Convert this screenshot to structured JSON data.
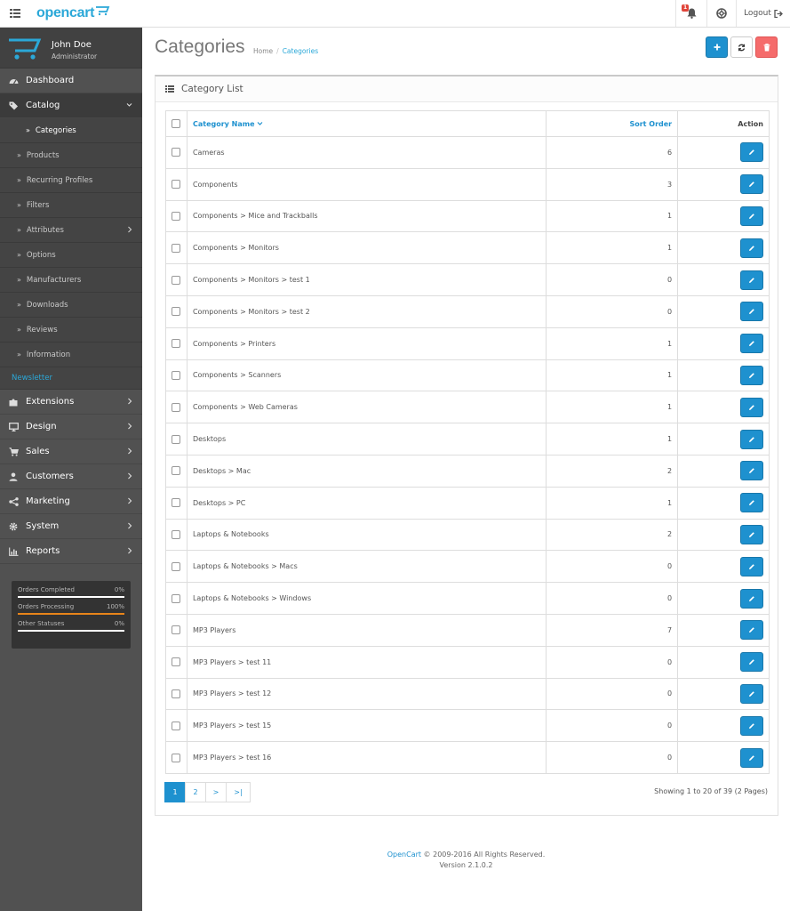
{
  "header": {
    "logo_text": "opencart",
    "notification_count": "1",
    "logout_label": "Logout"
  },
  "profile": {
    "name": "John Doe",
    "role": "Administrator"
  },
  "nav": {
    "dashboard": "Dashboard",
    "catalog": "Catalog",
    "catalog_sub": {
      "categories": "Categories",
      "products": "Products",
      "recurring": "Recurring Profiles",
      "filters": "Filters",
      "attributes": "Attributes",
      "options": "Options",
      "manufacturers": "Manufacturers",
      "downloads": "Downloads",
      "reviews": "Reviews",
      "information": "Information"
    },
    "newsletter": "Newsletter",
    "extensions": "Extensions",
    "design": "Design",
    "sales": "Sales",
    "customers": "Customers",
    "marketing": "Marketing",
    "system": "System",
    "reports": "Reports"
  },
  "stats": [
    {
      "label": "Orders Completed",
      "value": "0%",
      "fraction": 0
    },
    {
      "label": "Orders Processing",
      "value": "100%",
      "fraction": 1
    },
    {
      "label": "Other Statuses",
      "value": "0%",
      "fraction": 0
    }
  ],
  "page": {
    "title": "Categories",
    "breadcrumb_home": "Home",
    "breadcrumb_sep": "/",
    "breadcrumb_current": "Categories"
  },
  "panel": {
    "title": "Category List"
  },
  "table": {
    "col_name": "Category Name",
    "col_sort": "Sort Order",
    "col_action": "Action",
    "rows": [
      {
        "name": "Cameras",
        "sort": "6"
      },
      {
        "name": "Components",
        "sort": "3"
      },
      {
        "name": "Components  >  Mice and Trackballs",
        "sort": "1"
      },
      {
        "name": "Components  >  Monitors",
        "sort": "1"
      },
      {
        "name": "Components  >  Monitors  >  test 1",
        "sort": "0"
      },
      {
        "name": "Components  >  Monitors  >  test 2",
        "sort": "0"
      },
      {
        "name": "Components  >  Printers",
        "sort": "1"
      },
      {
        "name": "Components  >  Scanners",
        "sort": "1"
      },
      {
        "name": "Components  >  Web Cameras",
        "sort": "1"
      },
      {
        "name": "Desktops",
        "sort": "1"
      },
      {
        "name": "Desktops  >  Mac",
        "sort": "2"
      },
      {
        "name": "Desktops  >  PC",
        "sort": "1"
      },
      {
        "name": "Laptops & Notebooks",
        "sort": "2"
      },
      {
        "name": "Laptops & Notebooks  >  Macs",
        "sort": "0"
      },
      {
        "name": "Laptops & Notebooks  >  Windows",
        "sort": "0"
      },
      {
        "name": "MP3 Players",
        "sort": "7"
      },
      {
        "name": "MP3 Players  >  test 11",
        "sort": "0"
      },
      {
        "name": "MP3 Players  >  test 12",
        "sort": "0"
      },
      {
        "name": "MP3 Players  >  test 15",
        "sort": "0"
      },
      {
        "name": "MP3 Players  >  test 16",
        "sort": "0"
      }
    ]
  },
  "pagination": {
    "pages": [
      "1",
      "2",
      ">",
      ">|"
    ],
    "active": "1",
    "showing": "Showing 1 to 20 of 39 (2 Pages)"
  },
  "footer": {
    "link": "OpenCart",
    "text": " © 2009-2016 All Rights Reserved.",
    "version": "Version 2.1.0.2"
  },
  "colors": {
    "accent": "#1e91cf",
    "danger": "#f56b6b",
    "sidebar": "#515151",
    "progress": "#e8841a"
  }
}
